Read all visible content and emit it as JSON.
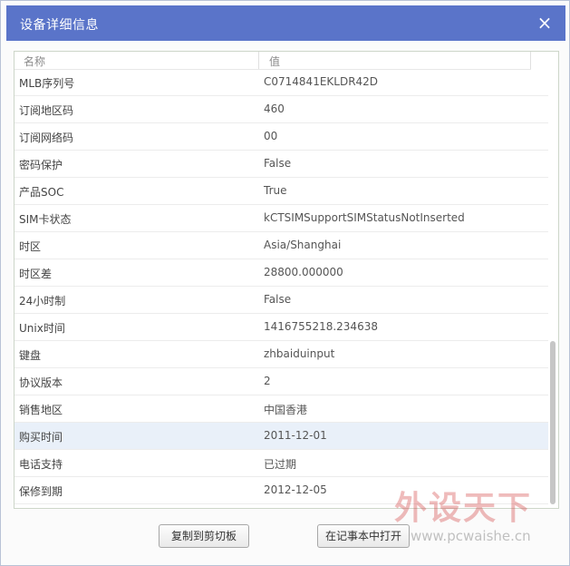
{
  "dialog": {
    "title": "设备详细信息",
    "close_glyph": "×",
    "close_icon": "close-icon"
  },
  "table": {
    "columns": [
      "名称",
      "值"
    ],
    "rows": [
      {
        "key": "MLB序列号",
        "value": "C0714841EKLDR42D"
      },
      {
        "key": "订阅地区码",
        "value": "460"
      },
      {
        "key": "订阅网络码",
        "value": "00"
      },
      {
        "key": "密码保护",
        "value": "False"
      },
      {
        "key": "产品SOC",
        "value": "True"
      },
      {
        "key": "SIM卡状态",
        "value": "kCTSIMSupportSIMStatusNotInserted"
      },
      {
        "key": "时区",
        "value": "Asia/Shanghai"
      },
      {
        "key": "时区差",
        "value": "28800.000000"
      },
      {
        "key": "24小时制",
        "value": "False"
      },
      {
        "key": "Unix时间",
        "value": "1416755218.234638"
      },
      {
        "key": "键盘",
        "value": "zhbaiduinput"
      },
      {
        "key": "协议版本",
        "value": "2"
      },
      {
        "key": "销售地区",
        "value": "中国香港"
      },
      {
        "key": "购买时间",
        "value": "2011-12-01",
        "selected": true
      },
      {
        "key": "电话支持",
        "value": "已过期"
      },
      {
        "key": "保修到期",
        "value": "2012-12-05"
      }
    ]
  },
  "footer": {
    "copy_label": "复制到剪切板",
    "open_notepad_label": "在记事本中打开"
  },
  "watermark": {
    "title": "外设天下",
    "url": "www.pcwaishe.cn"
  },
  "colors": {
    "titlebar": "#5a74c9",
    "selected_row": "#e9f0f9"
  }
}
